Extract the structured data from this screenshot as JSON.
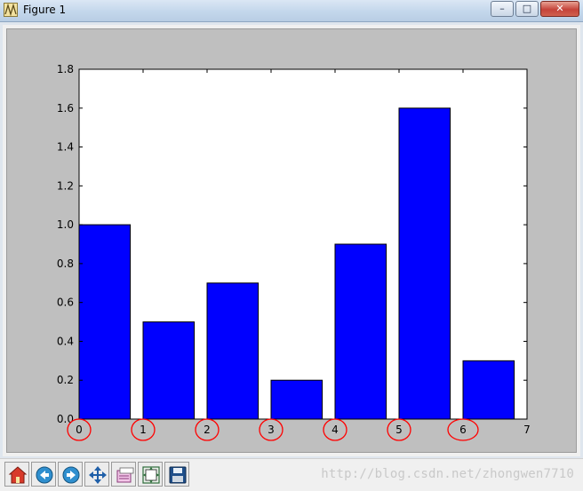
{
  "window": {
    "title": "Figure 1",
    "minimize_glyph": "–",
    "maximize_glyph": "□",
    "close_glyph": "✕"
  },
  "toolbar": {
    "buttons": [
      {
        "name": "home-button",
        "icon": "home-icon"
      },
      {
        "name": "back-button",
        "icon": "back-arrow-icon"
      },
      {
        "name": "forward-button",
        "icon": "forward-arrow-icon"
      },
      {
        "name": "pan-button",
        "icon": "pan-move-icon"
      },
      {
        "name": "zoom-button",
        "icon": "zoom-rect-icon"
      },
      {
        "name": "subplots-button",
        "icon": "subplots-icon"
      },
      {
        "name": "save-button",
        "icon": "save-disk-icon"
      }
    ]
  },
  "watermark": "http://blog.csdn.net/zhongwen7710",
  "colors": {
    "bar_fill": "#0000ff",
    "annotation_circle": "#ff0000",
    "figure_bg": "#bfbfbf",
    "axes_bg": "#ffffff"
  },
  "chart_data": {
    "type": "bar",
    "categories": [
      "0",
      "1",
      "2",
      "3",
      "4",
      "5",
      "6"
    ],
    "x": [
      0,
      1,
      2,
      3,
      4,
      5,
      6
    ],
    "values": [
      1.0,
      0.5,
      0.7,
      0.2,
      0.9,
      1.6,
      0.3
    ],
    "bar_width": 0.8,
    "xlim": [
      0,
      7
    ],
    "ylim": [
      0,
      1.8
    ],
    "xticks": [
      "0",
      "1",
      "2",
      "3",
      "4",
      "5",
      "6",
      "7"
    ],
    "yticks": [
      "0.0",
      "0.2",
      "0.4",
      "0.6",
      "0.8",
      "1.0",
      "1.2",
      "1.4",
      "1.6",
      "1.8"
    ],
    "grid": false,
    "annotations": "red circles around x tick labels 0 through 6"
  }
}
